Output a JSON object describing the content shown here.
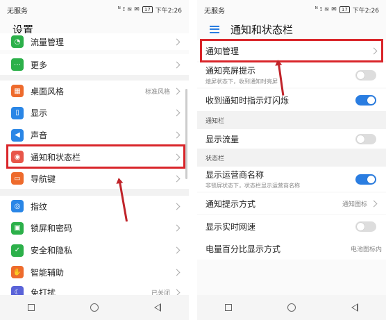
{
  "status_bar": {
    "carrier": "无服务",
    "icons": "ᴺ ⟟ ≋ ✉",
    "battery": "17",
    "time": "下午2:26"
  },
  "left": {
    "title": "设置",
    "items": [
      {
        "label": "流量管理",
        "icon": "data-usage-icon",
        "color": "#2cb04a",
        "glyph": "◔",
        "value": ""
      },
      {
        "label": "更多",
        "icon": "more-icon",
        "color": "#2cb04a",
        "glyph": "⋯",
        "value": ""
      },
      {
        "label": "桌面风格",
        "icon": "home-style-icon",
        "color": "#ee6b2d",
        "glyph": "▦",
        "value": "标准风格"
      },
      {
        "label": "显示",
        "icon": "display-icon",
        "color": "#2a86e6",
        "glyph": "▯",
        "value": ""
      },
      {
        "label": "声音",
        "icon": "sound-icon",
        "color": "#2a86e6",
        "glyph": "◀",
        "value": ""
      },
      {
        "label": "通知和状态栏",
        "icon": "notification-icon",
        "color": "#e8564a",
        "glyph": "◉",
        "value": ""
      },
      {
        "label": "导航键",
        "icon": "navigation-key-icon",
        "color": "#ee6b2d",
        "glyph": "▭",
        "value": ""
      },
      {
        "label": "指纹",
        "icon": "fingerprint-icon",
        "color": "#2a86e6",
        "glyph": "◎",
        "value": ""
      },
      {
        "label": "锁屏和密码",
        "icon": "lock-icon",
        "color": "#2cb04a",
        "glyph": "▣",
        "value": ""
      },
      {
        "label": "安全和隐私",
        "icon": "shield-icon",
        "color": "#2cb04a",
        "glyph": "✓",
        "value": ""
      },
      {
        "label": "智能辅助",
        "icon": "hand-icon",
        "color": "#ee6b2d",
        "glyph": "✋",
        "value": ""
      },
      {
        "label": "免打扰",
        "icon": "moon-icon",
        "color": "#5a63d8",
        "glyph": "☾",
        "value": "已关闭"
      }
    ]
  },
  "right": {
    "title": "通知和状态栏",
    "notification_manage": "通知管理",
    "lock_screen_notif": {
      "label": "通知亮屏提示",
      "sub": "熄屏状态下，收到通知时亮屏",
      "on": false
    },
    "led_notif": {
      "label": "收到通知时指示灯闪烁",
      "on": true
    },
    "section_notifbar": "通知栏",
    "show_traffic": {
      "label": "显示流量",
      "on": false
    },
    "section_statusbar": "状态栏",
    "show_carrier": {
      "label": "显示运营商名称",
      "sub": "非锁屏状态下，状态栏显示运营商名称",
      "on": true
    },
    "notif_style": {
      "label": "通知提示方式",
      "value": "通知图标"
    },
    "realtime_speed": {
      "label": "显示实时网速",
      "on": false
    },
    "battery_pct": {
      "label": "电量百分比显示方式",
      "value": "电池图标内"
    }
  }
}
